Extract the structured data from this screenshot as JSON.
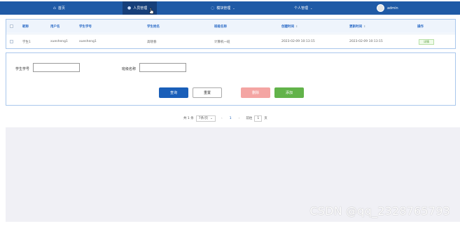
{
  "nav": {
    "home": "首页",
    "personnel": "人员管理",
    "modules": "模块管理",
    "personal": "个人管理",
    "user": "admin"
  },
  "table": {
    "headers": [
      "昵称",
      "用户名",
      "学生学号",
      "学生姓名",
      "班级名称",
      "创建时间",
      "更新时间",
      "操作"
    ],
    "rows": [
      {
        "nickname": "学生1",
        "username": "xuesheng1",
        "student_no": "xuesheng1",
        "student_name": "高晓春",
        "class_name": "计算机一班",
        "created": "2023-02-09 10:13:15",
        "updated": "2023-02-09 10:13:15",
        "action": "详情"
      }
    ]
  },
  "search": {
    "student_no_label": "学生学号",
    "class_name_label": "班级名称",
    "student_no_value": "",
    "class_name_value": "",
    "query_button": "查询",
    "reset_button": "重置",
    "delete_button": "删除",
    "add_button": "添加"
  },
  "pager": {
    "total": "共 1 条",
    "page_size": "7条/页",
    "prev": "‹",
    "current_page": "1",
    "next": "›",
    "goto_label": "前往",
    "goto_value": "1",
    "page_unit": "页"
  },
  "watermark": "CSDN @qq_2328765793",
  "colors": {
    "nav_bg": "#1f5aa6",
    "query_button": "#1a5fb9",
    "delete_button": "#f4a5a3",
    "add_button": "#62b34a"
  }
}
